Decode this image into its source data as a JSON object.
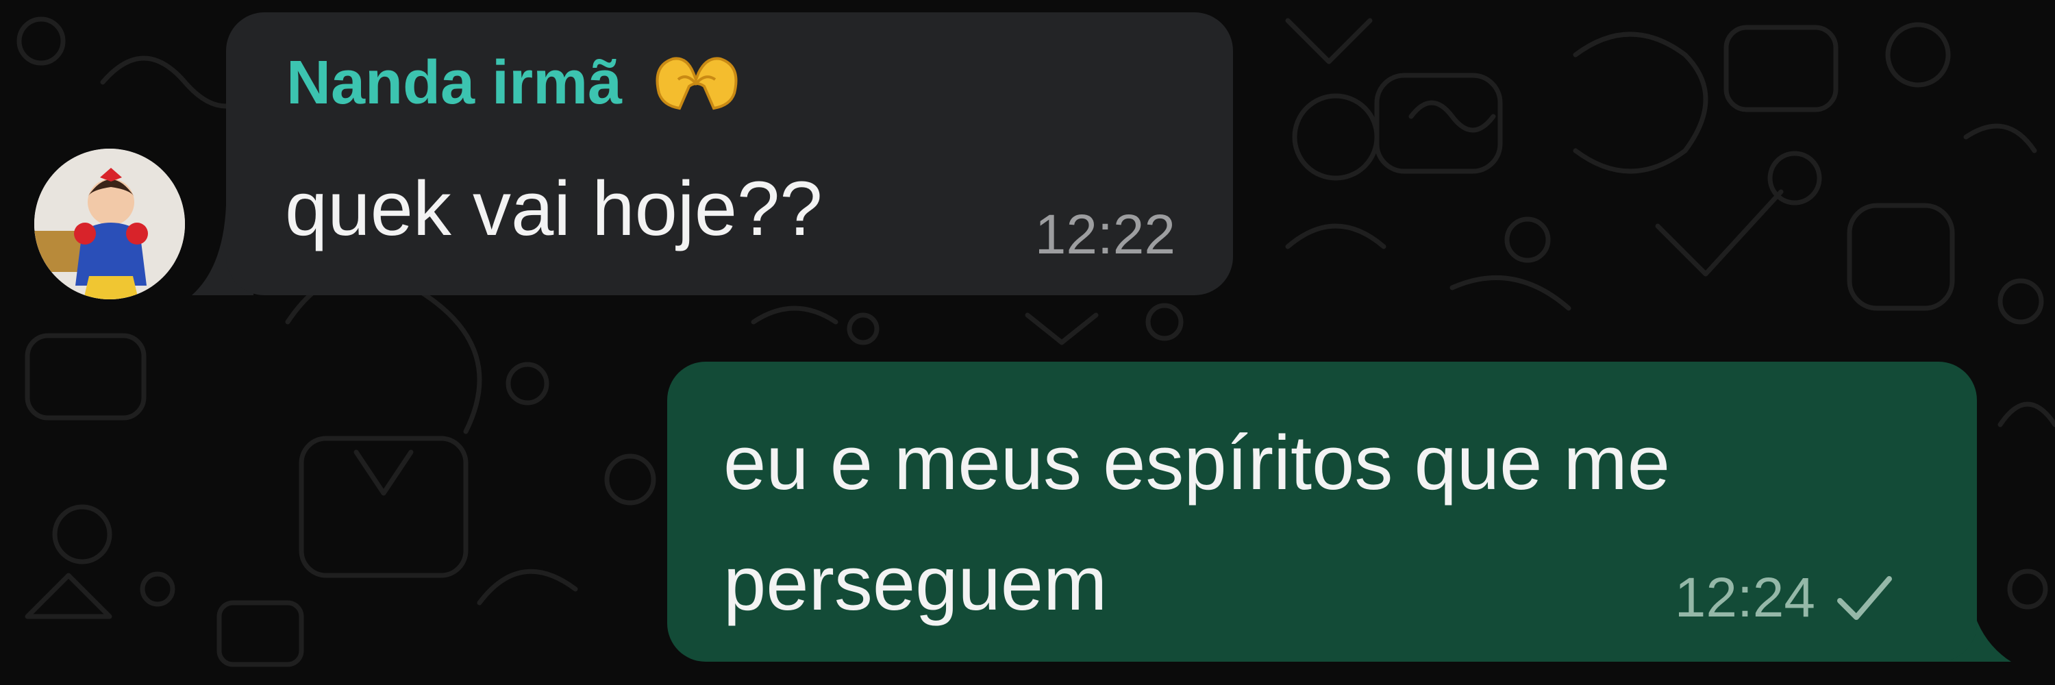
{
  "messages": {
    "incoming": {
      "sender": "Nanda irmã",
      "sender_emoji": "heart-hands-emoji",
      "text": "quek vai hoje??",
      "time": "12:22"
    },
    "outgoing": {
      "text": "eu e meus espíritos que me perseguem",
      "time": "12:24",
      "status_icon": "single-check-icon"
    }
  },
  "colors": {
    "background": "#0b0b0b",
    "incoming_bubble": "#232426",
    "outgoing_bubble": "#134b37",
    "sender_name": "#3cc4b0",
    "message_text": "#f3f3f3",
    "timestamp": "#9d9ea0"
  }
}
